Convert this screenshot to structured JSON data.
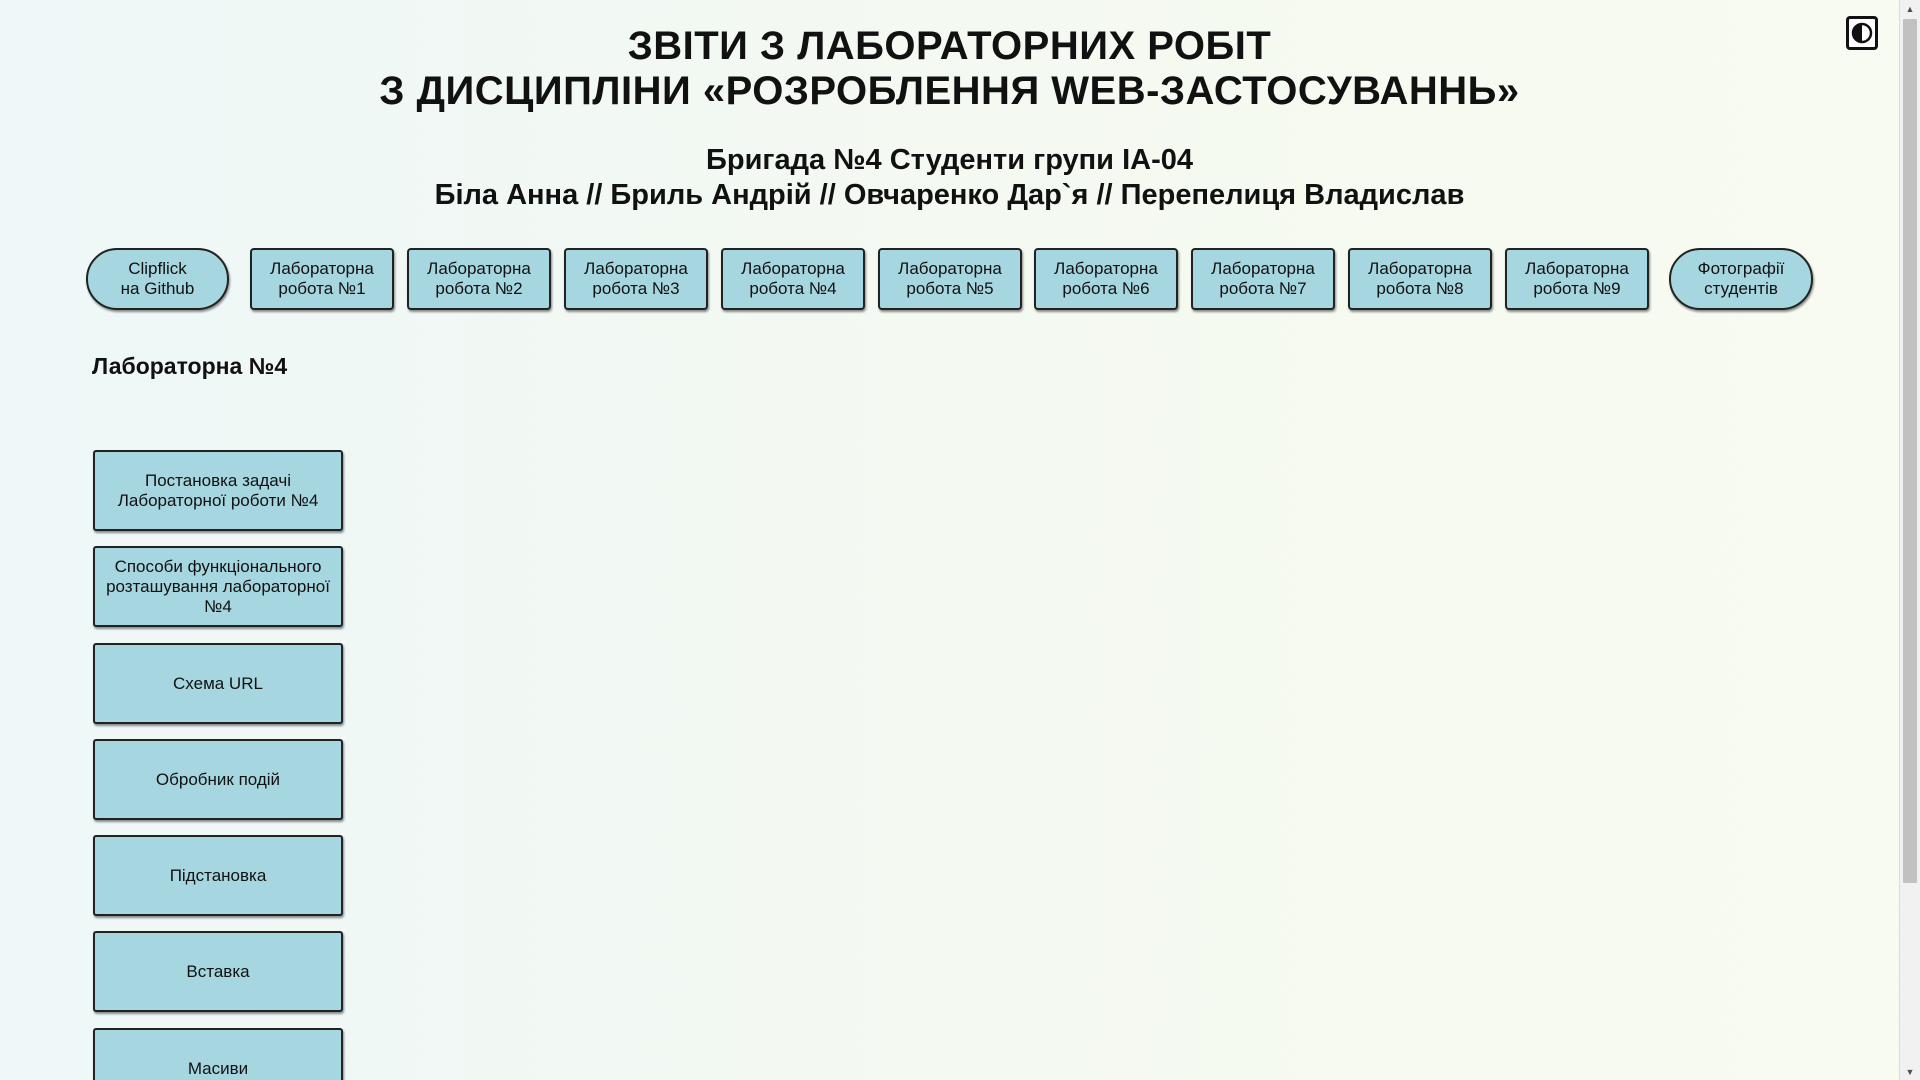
{
  "header": {
    "title_line1": "ЗВІТИ З ЛАБОРАТОРНИХ РОБІТ",
    "title_line2": "З ДИСЦИПЛІНИ «РОЗРОБЛЕННЯ WEB-ЗАСТОСУВАННЬ»",
    "team_line": "Бригада №4 Студенти групи ІА-04",
    "members_line": "Біла Анна // Бриль Андрій // Овчаренко Дар`я // Перепелиця Владислав"
  },
  "theme_toggle": {
    "icon": "contrast-icon"
  },
  "nav": {
    "github": "Clipflick\nна Github",
    "lab1": "Лабораторна\nробота №1",
    "lab2": "Лабораторна\nробота №2",
    "lab3": "Лабораторна\nробота №3",
    "lab4": "Лабораторна\nробота №4",
    "lab5": "Лабораторна\nробота №5",
    "lab6": "Лабораторна\nробота №6",
    "lab7": "Лабораторна\nробота №7",
    "lab8": "Лабораторна\nробота №8",
    "lab9": "Лабораторна\nробота №9",
    "photos": "Фотографії\nстудентів"
  },
  "section_title": "Лабораторна №4",
  "side_menu": {
    "item1": "Постановка задачі Лабораторної роботи №4",
    "item2": "Способи функціонального розташування лабораторної №4",
    "item3": "Схема URL",
    "item4": "Обробник подій",
    "item5": "Підстановка",
    "item6": "Вставка",
    "item7": "Масиви"
  },
  "colors": {
    "button_bg": "#a6d6e0",
    "border": "#222222",
    "page_bg": "#f4f9f1"
  }
}
